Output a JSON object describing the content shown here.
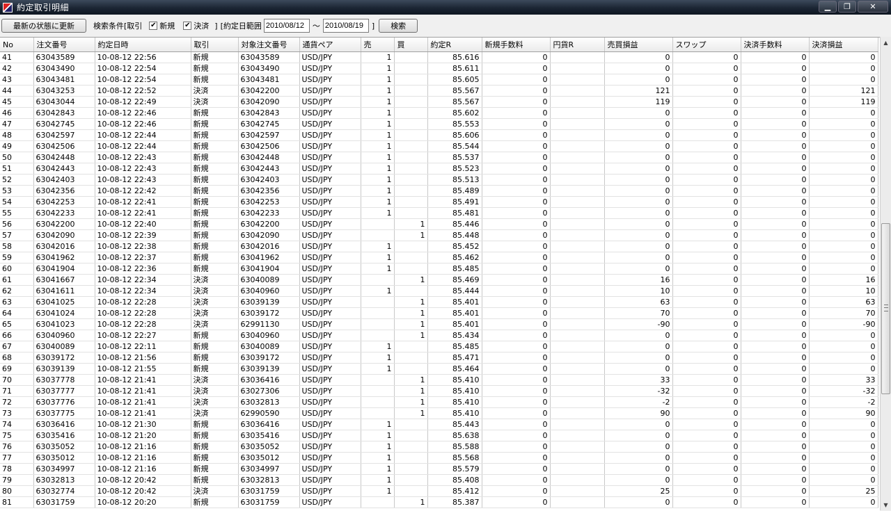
{
  "window": {
    "title": "約定取引明細",
    "minimize": "▁",
    "restore": "❐",
    "close": "✕"
  },
  "toolbar": {
    "refresh_label": "最新の状態に更新",
    "search_condition_label": "検索条件[取引",
    "new_label": "新規",
    "settle_label": "決済",
    "close_bracket": "]",
    "date_range_label": "[約定日範囲",
    "date_from": "2010/08/12",
    "tilde": "～",
    "date_to": "2010/08/19",
    "date_close_bracket": "]",
    "search_label": "検索",
    "new_checked": true,
    "settle_checked": true
  },
  "columns": [
    "No",
    "注文番号",
    "約定日時",
    "取引",
    "対象注文番号",
    "通貨ペア",
    "売",
    "買",
    "約定R",
    "新規手数料",
    "円貨R",
    "売買損益",
    "スワップ",
    "決済手数料",
    "決済損益"
  ],
  "rows": [
    [
      "41",
      "63043589",
      "10-08-12 22:56",
      "新規",
      "63043589",
      "USD/JPY",
      "1",
      "",
      "85.616",
      "0",
      "",
      "0",
      "0",
      "0",
      "0"
    ],
    [
      "42",
      "63043490",
      "10-08-12 22:54",
      "新規",
      "63043490",
      "USD/JPY",
      "1",
      "",
      "85.611",
      "0",
      "",
      "0",
      "0",
      "0",
      "0"
    ],
    [
      "43",
      "63043481",
      "10-08-12 22:54",
      "新規",
      "63043481",
      "USD/JPY",
      "1",
      "",
      "85.605",
      "0",
      "",
      "0",
      "0",
      "0",
      "0"
    ],
    [
      "44",
      "63043253",
      "10-08-12 22:52",
      "決済",
      "63042200",
      "USD/JPY",
      "1",
      "",
      "85.567",
      "0",
      "",
      "121",
      "0",
      "0",
      "121"
    ],
    [
      "45",
      "63043044",
      "10-08-12 22:49",
      "決済",
      "63042090",
      "USD/JPY",
      "1",
      "",
      "85.567",
      "0",
      "",
      "119",
      "0",
      "0",
      "119"
    ],
    [
      "46",
      "63042843",
      "10-08-12 22:46",
      "新規",
      "63042843",
      "USD/JPY",
      "1",
      "",
      "85.602",
      "0",
      "",
      "0",
      "0",
      "0",
      "0"
    ],
    [
      "47",
      "63042745",
      "10-08-12 22:46",
      "新規",
      "63042745",
      "USD/JPY",
      "1",
      "",
      "85.553",
      "0",
      "",
      "0",
      "0",
      "0",
      "0"
    ],
    [
      "48",
      "63042597",
      "10-08-12 22:44",
      "新規",
      "63042597",
      "USD/JPY",
      "1",
      "",
      "85.606",
      "0",
      "",
      "0",
      "0",
      "0",
      "0"
    ],
    [
      "49",
      "63042506",
      "10-08-12 22:44",
      "新規",
      "63042506",
      "USD/JPY",
      "1",
      "",
      "85.544",
      "0",
      "",
      "0",
      "0",
      "0",
      "0"
    ],
    [
      "50",
      "63042448",
      "10-08-12 22:43",
      "新規",
      "63042448",
      "USD/JPY",
      "1",
      "",
      "85.537",
      "0",
      "",
      "0",
      "0",
      "0",
      "0"
    ],
    [
      "51",
      "63042443",
      "10-08-12 22:43",
      "新規",
      "63042443",
      "USD/JPY",
      "1",
      "",
      "85.523",
      "0",
      "",
      "0",
      "0",
      "0",
      "0"
    ],
    [
      "52",
      "63042403",
      "10-08-12 22:43",
      "新規",
      "63042403",
      "USD/JPY",
      "1",
      "",
      "85.513",
      "0",
      "",
      "0",
      "0",
      "0",
      "0"
    ],
    [
      "53",
      "63042356",
      "10-08-12 22:42",
      "新規",
      "63042356",
      "USD/JPY",
      "1",
      "",
      "85.489",
      "0",
      "",
      "0",
      "0",
      "0",
      "0"
    ],
    [
      "54",
      "63042253",
      "10-08-12 22:41",
      "新規",
      "63042253",
      "USD/JPY",
      "1",
      "",
      "85.491",
      "0",
      "",
      "0",
      "0",
      "0",
      "0"
    ],
    [
      "55",
      "63042233",
      "10-08-12 22:41",
      "新規",
      "63042233",
      "USD/JPY",
      "1",
      "",
      "85.481",
      "0",
      "",
      "0",
      "0",
      "0",
      "0"
    ],
    [
      "56",
      "63042200",
      "10-08-12 22:40",
      "新規",
      "63042200",
      "USD/JPY",
      "",
      "1",
      "85.446",
      "0",
      "",
      "0",
      "0",
      "0",
      "0"
    ],
    [
      "57",
      "63042090",
      "10-08-12 22:39",
      "新規",
      "63042090",
      "USD/JPY",
      "",
      "1",
      "85.448",
      "0",
      "",
      "0",
      "0",
      "0",
      "0"
    ],
    [
      "58",
      "63042016",
      "10-08-12 22:38",
      "新規",
      "63042016",
      "USD/JPY",
      "1",
      "",
      "85.452",
      "0",
      "",
      "0",
      "0",
      "0",
      "0"
    ],
    [
      "59",
      "63041962",
      "10-08-12 22:37",
      "新規",
      "63041962",
      "USD/JPY",
      "1",
      "",
      "85.462",
      "0",
      "",
      "0",
      "0",
      "0",
      "0"
    ],
    [
      "60",
      "63041904",
      "10-08-12 22:36",
      "新規",
      "63041904",
      "USD/JPY",
      "1",
      "",
      "85.485",
      "0",
      "",
      "0",
      "0",
      "0",
      "0"
    ],
    [
      "61",
      "63041667",
      "10-08-12 22:34",
      "決済",
      "63040089",
      "USD/JPY",
      "",
      "1",
      "85.469",
      "0",
      "",
      "16",
      "0",
      "0",
      "16"
    ],
    [
      "62",
      "63041611",
      "10-08-12 22:34",
      "決済",
      "63040960",
      "USD/JPY",
      "1",
      "",
      "85.444",
      "0",
      "",
      "10",
      "0",
      "0",
      "10"
    ],
    [
      "63",
      "63041025",
      "10-08-12 22:28",
      "決済",
      "63039139",
      "USD/JPY",
      "",
      "1",
      "85.401",
      "0",
      "",
      "63",
      "0",
      "0",
      "63"
    ],
    [
      "64",
      "63041024",
      "10-08-12 22:28",
      "決済",
      "63039172",
      "USD/JPY",
      "",
      "1",
      "85.401",
      "0",
      "",
      "70",
      "0",
      "0",
      "70"
    ],
    [
      "65",
      "63041023",
      "10-08-12 22:28",
      "決済",
      "62991130",
      "USD/JPY",
      "",
      "1",
      "85.401",
      "0",
      "",
      "-90",
      "0",
      "0",
      "-90"
    ],
    [
      "66",
      "63040960",
      "10-08-12 22:27",
      "新規",
      "63040960",
      "USD/JPY",
      "",
      "1",
      "85.434",
      "0",
      "",
      "0",
      "0",
      "0",
      "0"
    ],
    [
      "67",
      "63040089",
      "10-08-12 22:11",
      "新規",
      "63040089",
      "USD/JPY",
      "1",
      "",
      "85.485",
      "0",
      "",
      "0",
      "0",
      "0",
      "0"
    ],
    [
      "68",
      "63039172",
      "10-08-12 21:56",
      "新規",
      "63039172",
      "USD/JPY",
      "1",
      "",
      "85.471",
      "0",
      "",
      "0",
      "0",
      "0",
      "0"
    ],
    [
      "69",
      "63039139",
      "10-08-12 21:55",
      "新規",
      "63039139",
      "USD/JPY",
      "1",
      "",
      "85.464",
      "0",
      "",
      "0",
      "0",
      "0",
      "0"
    ],
    [
      "70",
      "63037778",
      "10-08-12 21:41",
      "決済",
      "63036416",
      "USD/JPY",
      "",
      "1",
      "85.410",
      "0",
      "",
      "33",
      "0",
      "0",
      "33"
    ],
    [
      "71",
      "63037777",
      "10-08-12 21:41",
      "決済",
      "63027306",
      "USD/JPY",
      "",
      "1",
      "85.410",
      "0",
      "",
      "-32",
      "0",
      "0",
      "-32"
    ],
    [
      "72",
      "63037776",
      "10-08-12 21:41",
      "決済",
      "63032813",
      "USD/JPY",
      "",
      "1",
      "85.410",
      "0",
      "",
      "-2",
      "0",
      "0",
      "-2"
    ],
    [
      "73",
      "63037775",
      "10-08-12 21:41",
      "決済",
      "62990590",
      "USD/JPY",
      "",
      "1",
      "85.410",
      "0",
      "",
      "90",
      "0",
      "0",
      "90"
    ],
    [
      "74",
      "63036416",
      "10-08-12 21:30",
      "新規",
      "63036416",
      "USD/JPY",
      "1",
      "",
      "85.443",
      "0",
      "",
      "0",
      "0",
      "0",
      "0"
    ],
    [
      "75",
      "63035416",
      "10-08-12 21:20",
      "新規",
      "63035416",
      "USD/JPY",
      "1",
      "",
      "85.638",
      "0",
      "",
      "0",
      "0",
      "0",
      "0"
    ],
    [
      "76",
      "63035052",
      "10-08-12 21:16",
      "新規",
      "63035052",
      "USD/JPY",
      "1",
      "",
      "85.588",
      "0",
      "",
      "0",
      "0",
      "0",
      "0"
    ],
    [
      "77",
      "63035012",
      "10-08-12 21:16",
      "新規",
      "63035012",
      "USD/JPY",
      "1",
      "",
      "85.568",
      "0",
      "",
      "0",
      "0",
      "0",
      "0"
    ],
    [
      "78",
      "63034997",
      "10-08-12 21:16",
      "新規",
      "63034997",
      "USD/JPY",
      "1",
      "",
      "85.579",
      "0",
      "",
      "0",
      "0",
      "0",
      "0"
    ],
    [
      "79",
      "63032813",
      "10-08-12 20:42",
      "新規",
      "63032813",
      "USD/JPY",
      "1",
      "",
      "85.408",
      "0",
      "",
      "0",
      "0",
      "0",
      "0"
    ],
    [
      "80",
      "63032774",
      "10-08-12 20:42",
      "決済",
      "63031759",
      "USD/JPY",
      "1",
      "",
      "85.412",
      "0",
      "",
      "25",
      "0",
      "0",
      "25"
    ],
    [
      "81",
      "63031759",
      "10-08-12 20:20",
      "新規",
      "63031759",
      "USD/JPY",
      "",
      "1",
      "85.387",
      "0",
      "",
      "0",
      "0",
      "0",
      "0"
    ]
  ],
  "scrollbar": {
    "up_arrow": "▲",
    "down_arrow": "▼"
  }
}
